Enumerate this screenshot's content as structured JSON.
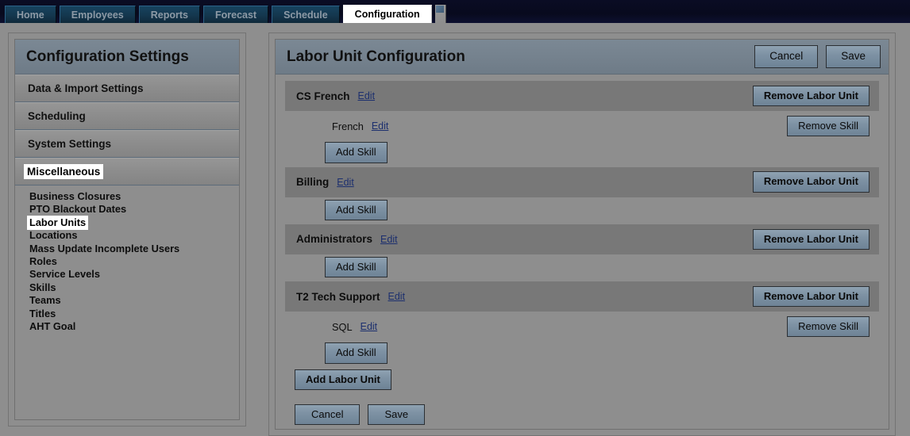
{
  "nav": {
    "tabs": [
      {
        "label": "Home",
        "active": false
      },
      {
        "label": "Employees",
        "active": false
      },
      {
        "label": "Reports",
        "active": false
      },
      {
        "label": "Forecast",
        "active": false
      },
      {
        "label": "Schedule",
        "active": false
      },
      {
        "label": "Configuration",
        "active": true
      }
    ]
  },
  "sidebar": {
    "title": "Configuration Settings",
    "sections": [
      {
        "label": "Data & Import Settings",
        "selected": false
      },
      {
        "label": "Scheduling",
        "selected": false
      },
      {
        "label": "System Settings",
        "selected": false
      },
      {
        "label": "Miscellaneous",
        "selected": true
      }
    ],
    "subitems": [
      {
        "label": "Business Closures",
        "selected": false
      },
      {
        "label": "PTO Blackout Dates",
        "selected": false
      },
      {
        "label": "Labor Units",
        "selected": true
      },
      {
        "label": "Locations",
        "selected": false
      },
      {
        "label": "Mass Update Incomplete Users",
        "selected": false
      },
      {
        "label": "Roles",
        "selected": false
      },
      {
        "label": "Service Levels",
        "selected": false
      },
      {
        "label": "Skills",
        "selected": false
      },
      {
        "label": "Teams",
        "selected": false
      },
      {
        "label": "Titles",
        "selected": false
      },
      {
        "label": "AHT Goal",
        "selected": false
      }
    ]
  },
  "main": {
    "title": "Labor Unit Configuration",
    "header_buttons": {
      "cancel": "Cancel",
      "save": "Save"
    },
    "labels": {
      "edit": "Edit",
      "remove_labor_unit": "Remove Labor Unit",
      "remove_skill": "Remove Skill",
      "add_skill": "Add Skill",
      "add_labor_unit": "Add Labor Unit"
    },
    "labor_units": [
      {
        "name": "CS French",
        "skills": [
          {
            "name": "French"
          }
        ]
      },
      {
        "name": "Billing",
        "skills": []
      },
      {
        "name": "Administrators",
        "skills": []
      },
      {
        "name": "T2 Tech Support",
        "skills": [
          {
            "name": "SQL"
          }
        ]
      }
    ],
    "footer_buttons": {
      "cancel": "Cancel",
      "save": "Save"
    }
  },
  "colors": {
    "page_bg": "#8e8e8e",
    "panel_header": "#75828e",
    "row_band": "#787878",
    "button": "#7e92a4",
    "link": "#1c2f6e",
    "tab_bar": "#090b22",
    "tab": "#14374e"
  }
}
